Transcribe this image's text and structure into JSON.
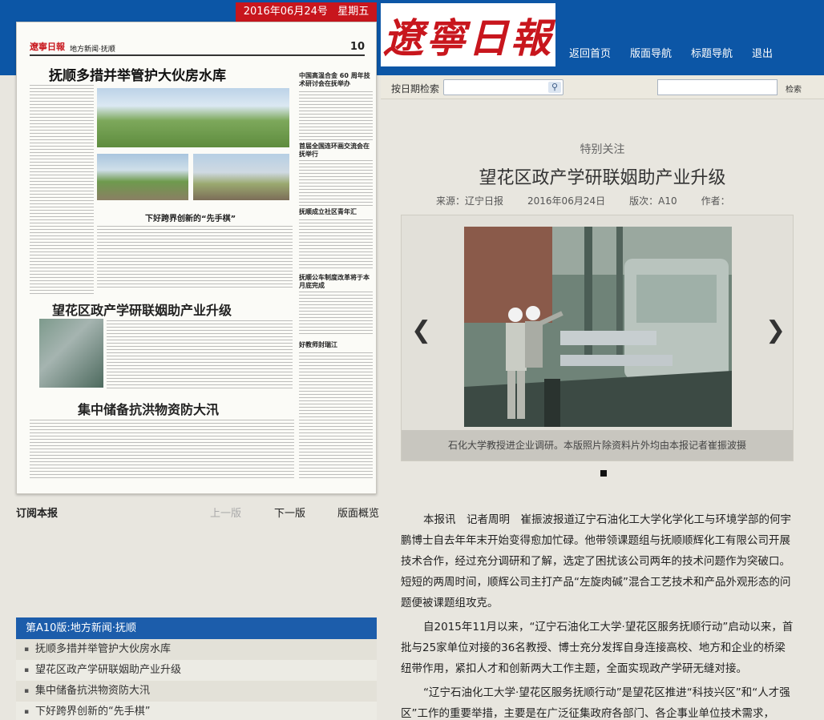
{
  "header": {
    "date": "2016年06月24号",
    "weekday": "星期五",
    "logo": "遼寧日報",
    "nav": [
      "返回首页",
      "版面导航",
      "标题导航",
      "退出"
    ]
  },
  "search": {
    "date_label": "按日期检索",
    "date_value": "",
    "keyword_value": "",
    "button": "检索"
  },
  "page_preview": {
    "masthead": "遼寧日報",
    "section": "地方新闻·抚顺",
    "page_number": "10",
    "headlines": [
      "抚顺多措并举管护大伙房水库",
      "下好跨界创新的“先手棋”",
      "望花区政产学研联姻助产业升级",
      "集中储备抗洪物资防大汛"
    ],
    "side_headlines": [
      "中国高温合金 60 周年技术研讨会在抚举办",
      "首届全国连环画交流会在抚举行",
      "抚顺成立社区青年汇",
      "抚顺公车制度改革将于本月底完成",
      "好教师封瑞江"
    ]
  },
  "pager": {
    "subscribe": "订阅本报",
    "prev": "上一版",
    "next": "下一版",
    "overview": "版面概览"
  },
  "article_list": {
    "heading": "第A10版:地方新闻·抚顺",
    "items": [
      "抚顺多措并举管护大伙房水库",
      "望花区政产学研联姻助产业升级",
      "集中储备抗洪物资防大汛",
      "下好跨界创新的“先手棋”"
    ]
  },
  "article": {
    "category": "特别关注",
    "title": "望花区政产学研联姻助产业升级",
    "source": "来源：辽宁日报",
    "date": "2016年06月24日",
    "page": "版次：A10",
    "author": "作者：",
    "caption": "石化大学教授进企业调研。本版照片除资料片外均由本报记者崔振波摄",
    "paragraphs": [
      "本报讯　记者周明　崔振波报道辽宁石油化工大学化学化工与环境学部的何宇鹏博士自去年年末开始变得愈加忙碌。他带领课题组与抚顺顺辉化工有限公司开展技术合作，经过充分调研和了解，选定了困扰该公司两年的技术问题作为突破口。短短的两周时间，顺辉公司主打产品“左旋肉碱”混合工艺技术和产品外观形态的问题便被课题组攻克。",
      "自2015年11月以来，“辽宁石油化工大学·望花区服务抚顺行动”启动以来，首批与25家单位对接的36名教授、博士充分发挥自身连接高校、地方和企业的桥梁纽带作用，紧扣人才和创新两大工作主题，全面实现政产学研无缝对接。",
      "“辽宁石油化工大学·望花区服务抚顺行动”是望花区推进“科技兴区”和“人才强区”工作的重要举措，主要是在广泛征集政府各部门、各企事业单位技术需求，"
    ]
  },
  "colors": {
    "header_blue": "#0c56a6",
    "date_red": "#c8161d",
    "list_blue": "#1c5dab"
  }
}
